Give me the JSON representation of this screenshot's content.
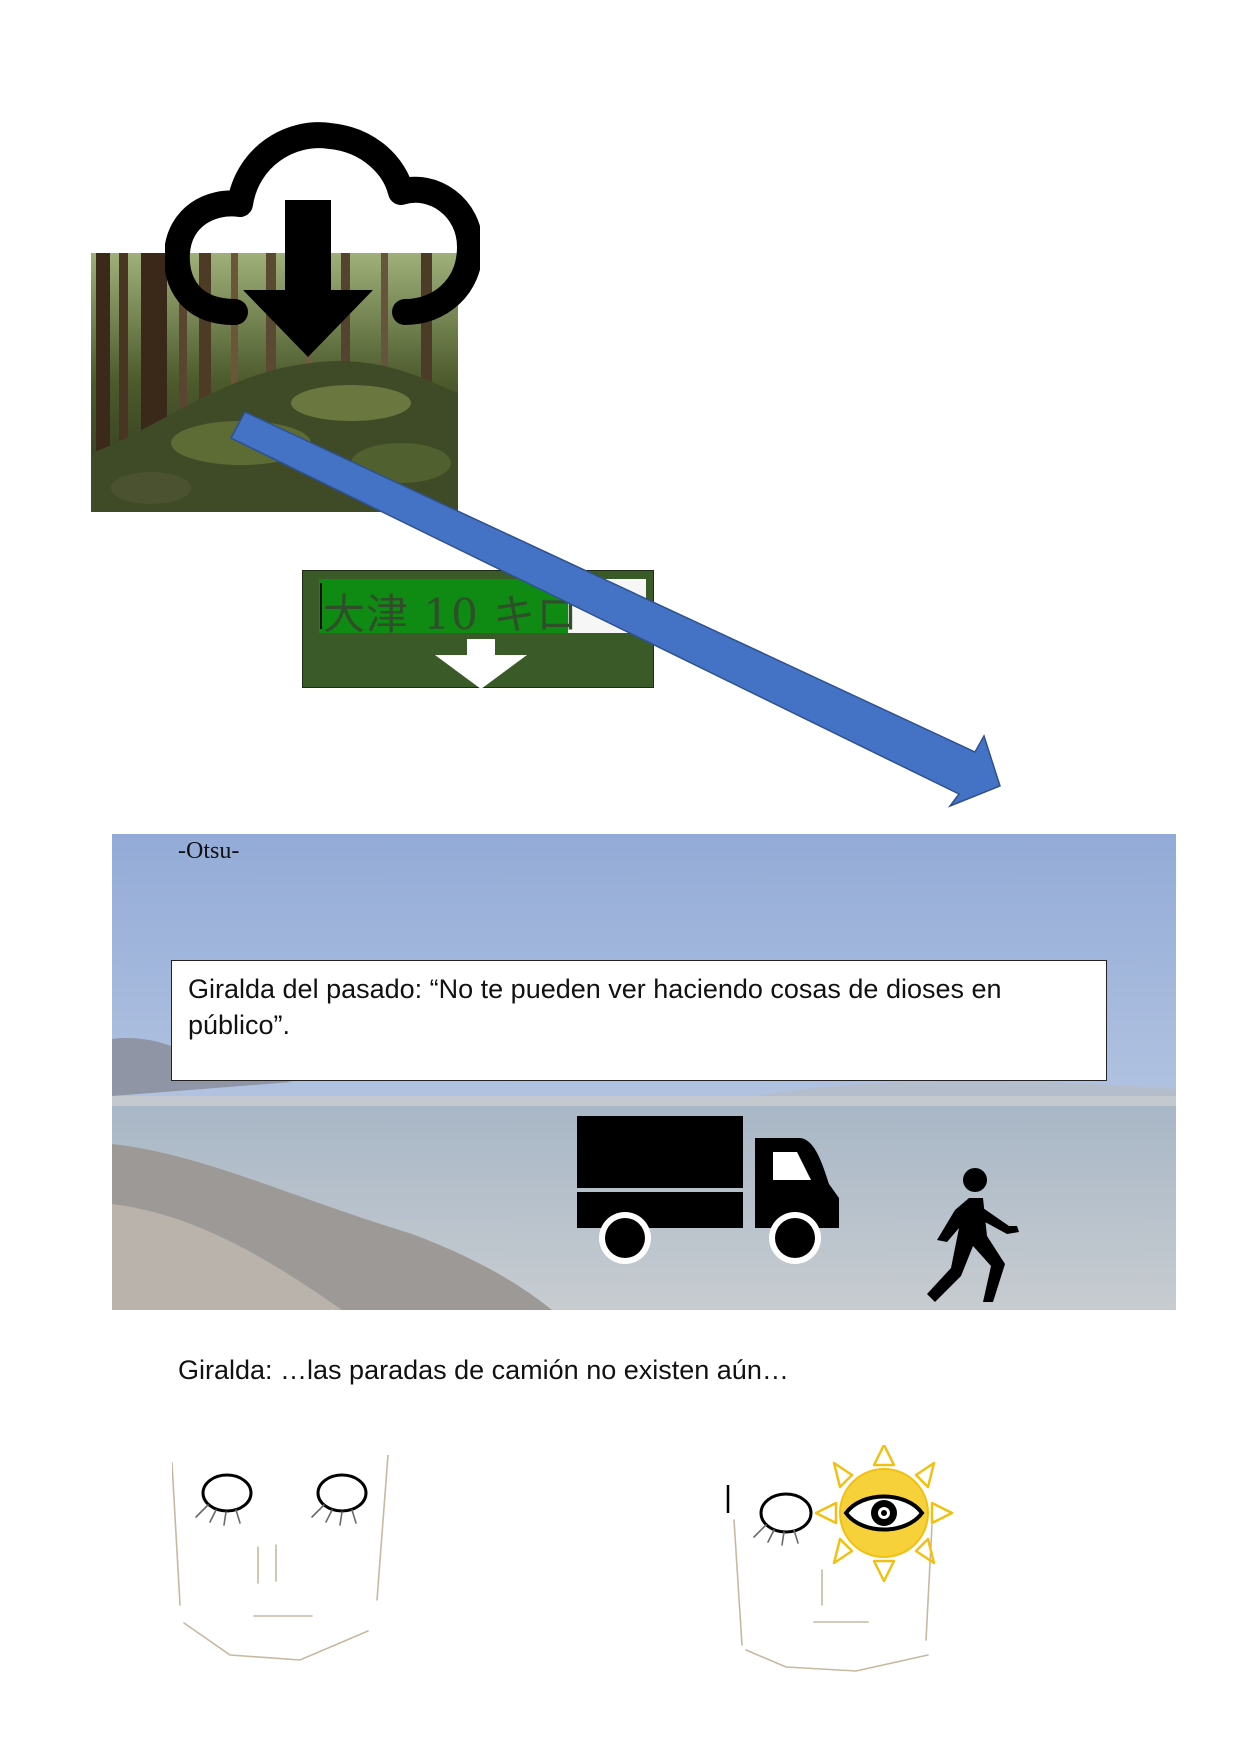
{
  "sign": {
    "text": "大津 10 キロ"
  },
  "scene": {
    "place_label": "-Otsu-",
    "dialogue": "Giralda del pasado: “No te pueden ver haciendo cosas de dioses en público”.",
    "icons": [
      "truck-icon",
      "walking-person-icon"
    ]
  },
  "caption": "Giralda: …las paradas de camión no existen aún…",
  "icons": {
    "top": "cloud-download-icon",
    "sign_arrow": "arrow-down-icon",
    "connector": "diagonal-arrow",
    "faces": [
      "face-sketch-closed-eyes",
      "face-sketch-divine-eye"
    ],
    "divine_eye": "sun-eye-icon"
  },
  "colors": {
    "connector_arrow": "#4472c4",
    "sign_green": "#3a5a28",
    "sign_text_highlight": "#0f8a12",
    "sun_yellow": "#f2c010"
  }
}
